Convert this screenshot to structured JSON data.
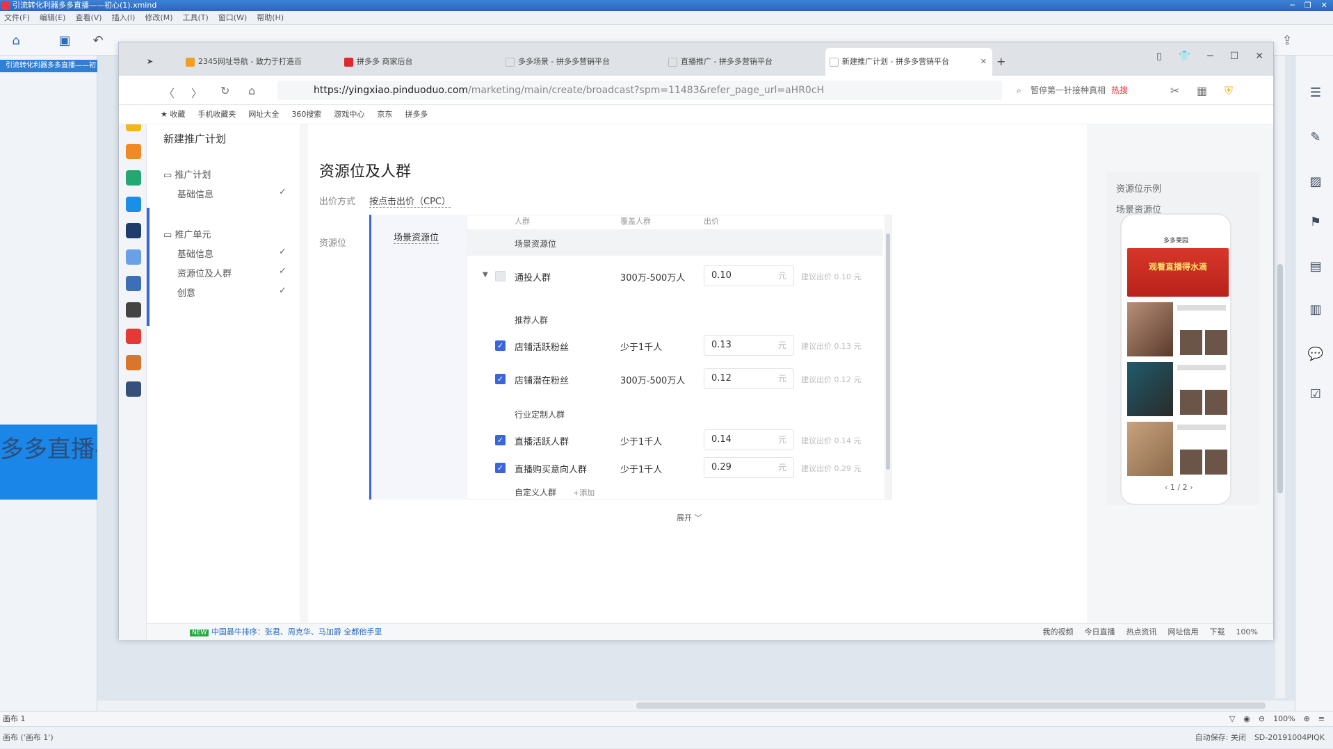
{
  "xmind": {
    "title": "引流转化利器多多直播——初心(1).xmind",
    "menu": [
      "文件(F)",
      "编辑(E)",
      "查看(V)",
      "插入(I)",
      "修改(M)",
      "工具(T)",
      "窗口(W)",
      "帮助(H)"
    ],
    "file_tab": "引流转化利器多多直播——初",
    "topic_text": "多多直播——初心",
    "sheet_label": "画布 1",
    "status_text": "画布 ('画布 1')",
    "zoom": "100%",
    "autosave": "自动保存: 关闭",
    "machine": "SD-20191004PIQK"
  },
  "browser": {
    "tabs": [
      {
        "label": "2345网址导航 - 致力于打造百",
        "color": "#f0a020"
      },
      {
        "label": "拼多多 商家后台",
        "color": "#e0282e"
      },
      {
        "label": "多多场景 - 拼多多营销平台",
        "color": "#bbbbbb"
      },
      {
        "label": "直播推广 - 拼多多营销平台",
        "color": "#bbbbbb"
      },
      {
        "label": "新建推广计划 - 拼多多营销平台",
        "color": "#bbbbbb"
      }
    ],
    "url_domain": "https://yingxiao.pinduoduo.com",
    "url_path": "/marketing/main/create/broadcast?spm=11483&refer_page_url=aHR0cH",
    "search_placeholder": "暂停第一针接种真相",
    "search_hot": "热搜",
    "bookmarks": [
      "收藏",
      "手机收藏夹",
      "网址大全",
      "360搜索",
      "游戏中心",
      "京东",
      "拼多多"
    ],
    "status_news": "中国最牛排序：张君、周克华、马加爵 全都他手里",
    "status_items": [
      "我的视频",
      "今日直播",
      "热点资讯",
      "网址信用",
      "下载",
      "100%"
    ]
  },
  "page": {
    "nav_title": "新建推广计划",
    "nav_plan": "推广计划",
    "nav_plan_basic": "基础信息",
    "nav_unit": "推广单元",
    "nav_unit_items": [
      "基础信息",
      "资源位及人群",
      "创意"
    ],
    "section_title": "资源位及人群",
    "bid_method_label": "出价方式",
    "bid_method_value": "按点击出价（CPC）",
    "resource_label": "资源位",
    "resource_item": "场景资源位",
    "table_headers": [
      "人群",
      "覆盖人群",
      "出价"
    ],
    "group_scene": "场景资源位",
    "row_general": {
      "name": "通投人群",
      "size": "300万-500万人",
      "bid": "0.10",
      "hint": "建议出价 0.10 元"
    },
    "group_recommend": "推荐人群",
    "recommend_rows": [
      {
        "name": "店铺活跃粉丝",
        "size": "少于1千人",
        "bid": "0.13",
        "hint": "建议出价 0.13 元"
      },
      {
        "name": "店铺潜在粉丝",
        "size": "300万-500万人",
        "bid": "0.12",
        "hint": "建议出价 0.12 元"
      }
    ],
    "group_industry": "行业定制人群",
    "industry_rows": [
      {
        "name": "直播活跃人群",
        "size": "少于1千人",
        "bid": "0.14",
        "hint": "建议出价 0.14 元"
      },
      {
        "name": "直播购买意向人群",
        "size": "少于1千人",
        "bid": "0.29",
        "hint": "建议出价 0.29 元"
      }
    ],
    "custom_label": "自定义人群",
    "add_label": "+添加",
    "unit": "元",
    "expand": "展开",
    "preview_title": "资源位示例",
    "preview_sub": "场景资源位",
    "phone_app": "多多果园",
    "phone_banner": "观看直播得水滴",
    "pager": "1 / 2"
  }
}
